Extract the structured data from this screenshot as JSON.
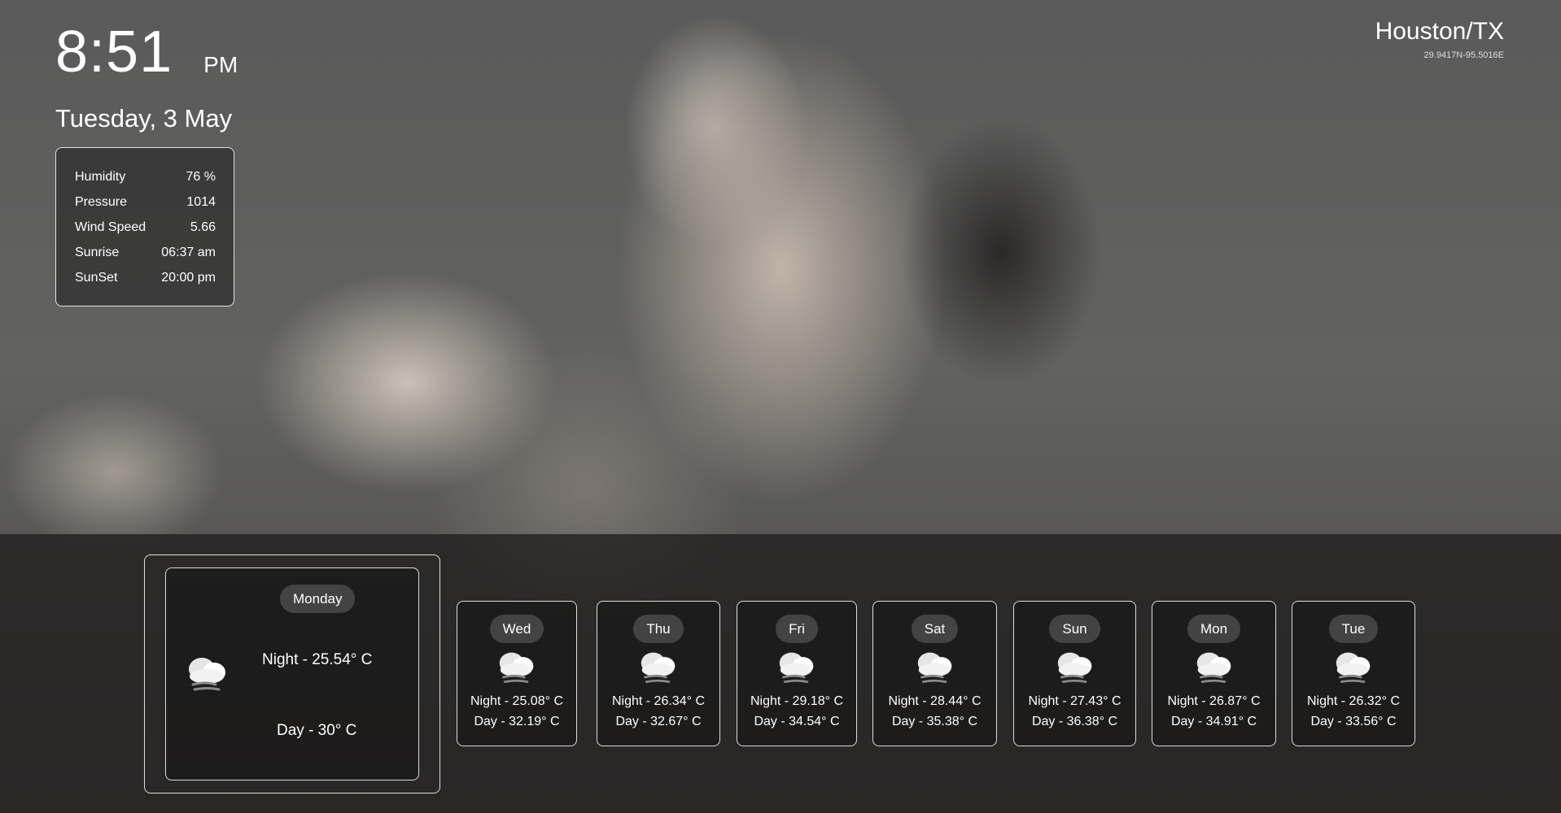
{
  "clock": {
    "time": "8:51",
    "ampm": "PM"
  },
  "date": "Tuesday, 3 May",
  "stats": [
    {
      "label": "Humidity",
      "value": "76 %"
    },
    {
      "label": "Pressure",
      "value": "1014"
    },
    {
      "label": "Wind Speed",
      "value": "5.66"
    },
    {
      "label": "Sunrise",
      "value": "06:37 am"
    },
    {
      "label": "SunSet",
      "value": "20:00 pm"
    }
  ],
  "location": {
    "city": "Houston/TX",
    "coords": "29.9417N-95.5016E"
  },
  "today": {
    "day": "Monday",
    "night": "Night - 25.54° C",
    "day_temp": "Day - 30° C",
    "icon": "cloud-wind-icon"
  },
  "forecast": [
    {
      "day": "Wed",
      "night": "Night - 25.08° C",
      "day_temp": "Day - 32.19° C",
      "icon": "cloud-wind-icon"
    },
    {
      "day": "Thu",
      "night": "Night - 26.34° C",
      "day_temp": "Day - 32.67° C",
      "icon": "cloud-wind-icon"
    },
    {
      "day": "Fri",
      "night": "Night - 29.18° C",
      "day_temp": "Day - 34.54° C",
      "icon": "cloud-wind-icon"
    },
    {
      "day": "Sat",
      "night": "Night - 28.44° C",
      "day_temp": "Day - 35.38° C",
      "icon": "cloud-wind-icon"
    },
    {
      "day": "Sun",
      "night": "Night - 27.43° C",
      "day_temp": "Day - 36.38° C",
      "icon": "cloud-wind-icon"
    },
    {
      "day": "Mon",
      "night": "Night - 26.87° C",
      "day_temp": "Day - 34.91° C",
      "icon": "cloud-wind-icon"
    },
    {
      "day": "Tue",
      "night": "Night - 26.32° C",
      "day_temp": "Day - 33.56° C",
      "icon": "cloud-wind-icon"
    }
  ]
}
